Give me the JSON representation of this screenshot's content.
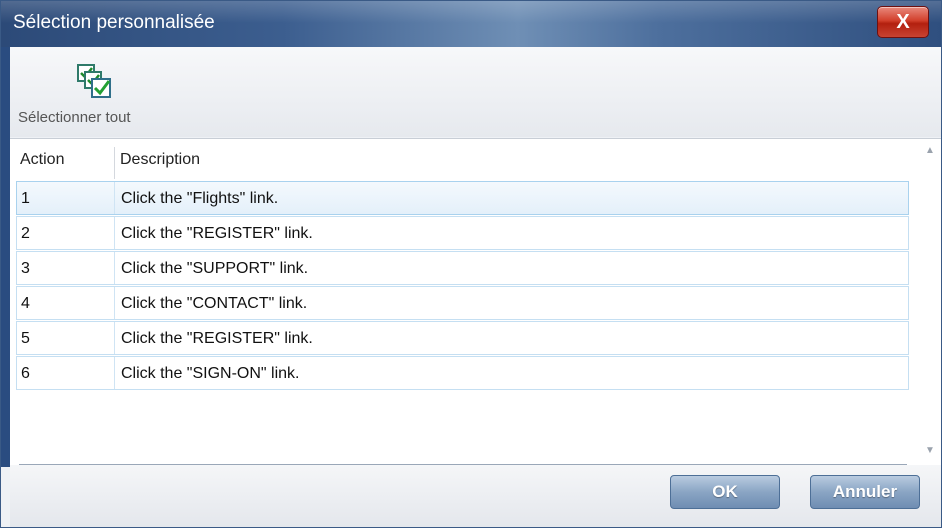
{
  "window": {
    "title": "Sélection personnalisée",
    "close_label": "X"
  },
  "toolbar": {
    "select_all_label": "Sélectionner tout",
    "select_all_icon": "select-all-checkboxes-icon"
  },
  "grid": {
    "columns": [
      "Action",
      "Description"
    ],
    "selected_row": 0,
    "rows": [
      {
        "action": "1",
        "description": "Click the \"Flights\" link."
      },
      {
        "action": "2",
        "description": "Click the \"REGISTER\" link."
      },
      {
        "action": "3",
        "description": "Click the \"SUPPORT\" link."
      },
      {
        "action": "4",
        "description": "Click the \"CONTACT\" link."
      },
      {
        "action": "5",
        "description": "Click the \"REGISTER\" link."
      },
      {
        "action": "6",
        "description": "Click the \"SIGN-ON\" link."
      }
    ]
  },
  "footer": {
    "ok_label": "OK",
    "cancel_label": "Annuler"
  },
  "colors": {
    "titlebar": "#2c4a78",
    "close_button": "#c8301c",
    "row_border": "#c5dff2",
    "selected_row": "#e4f0fa",
    "button": "#8aa5c4"
  }
}
